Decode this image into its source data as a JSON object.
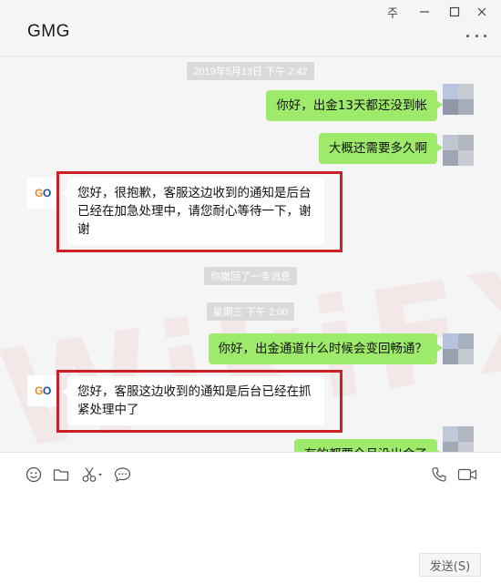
{
  "window": {
    "title": "GMG",
    "pin_glyph": "주"
  },
  "chat": {
    "timestamps": [
      "2019年5月13日 下午 2:42",
      "星期三 下午 2:00"
    ],
    "recall_notice": "你撤回了一条消息",
    "messages": [
      {
        "side": "out",
        "text": "你好，出金13天都还没到帐"
      },
      {
        "side": "out",
        "text": "大概还需要多久啊"
      },
      {
        "side": "in",
        "lines": [
          "您好，很抱歉，客服这边收到的通知是后台",
          "已经在加急处理中，请您耐心等待一下，谢",
          "谢"
        ]
      },
      {
        "side": "out",
        "text": "你好，出金通道什么时候会变回畅通？"
      },
      {
        "side": "in",
        "lines": [
          "您好，客服这边收到的通知是后台已经在抓",
          "紧处理中了"
        ]
      },
      {
        "side": "out",
        "text": "有的都要全月没出金了"
      }
    ],
    "contact_avatar": {
      "text_a": "G",
      "text_b": "O"
    },
    "watermark": "WikiFX"
  },
  "input": {
    "send_label": "发送(S)"
  },
  "icons": [
    "pin-icon",
    "minimize-icon",
    "maximize-icon",
    "close-icon",
    "more-icon",
    "emoji-icon",
    "folder-icon",
    "scissors-icon",
    "chat-bubble-icon",
    "phone-icon",
    "video-icon"
  ],
  "colors": {
    "outgoing_bubble": "#9eea6a",
    "incoming_bubble": "#ffffff",
    "highlight_border": "#cc1f26",
    "brand_orange": "#f08a1c",
    "brand_blue": "#1a4e9c"
  }
}
